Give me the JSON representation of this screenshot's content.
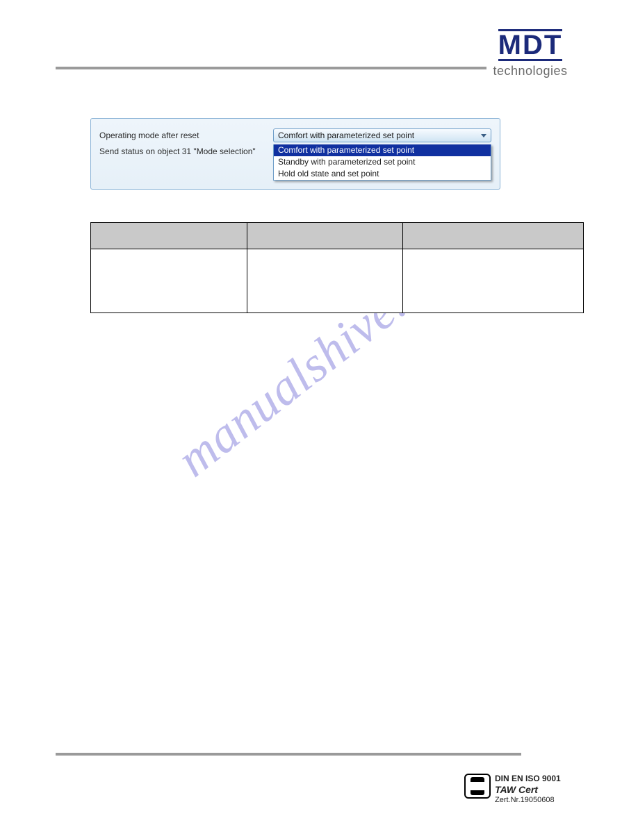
{
  "brand": {
    "mark": "MDT",
    "sub": "technologies"
  },
  "settings": {
    "row1_label": "Operating mode after reset",
    "row2_label": "Send status on object 31 \"Mode selection\"",
    "combo_value": "Comfort with parameterized set point",
    "options": [
      "Comfort with parameterized set point",
      "Standby with parameterized set point",
      "Hold old state and set point"
    ]
  },
  "watermark": "manualshive.com",
  "cert": {
    "l1": "DIN EN ISO 9001",
    "l2": "TAW Cert",
    "l3": "Zert.Nr.19050608"
  }
}
